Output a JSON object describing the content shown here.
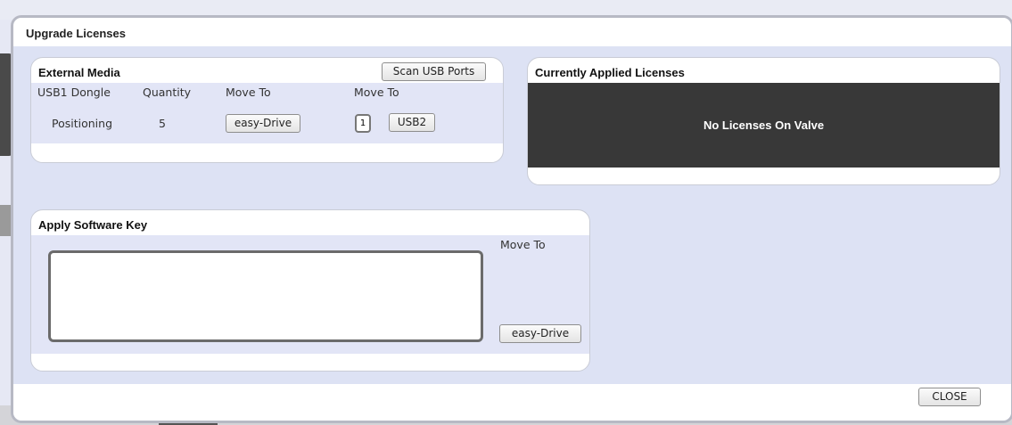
{
  "dialog": {
    "title": "Upgrade Licenses",
    "close_label": "CLOSE"
  },
  "external_media": {
    "title": "External Media",
    "scan_button": "Scan USB Ports",
    "columns": [
      "USB1 Dongle",
      "Quantity",
      "Move To",
      "Move To"
    ],
    "row": {
      "name": "Positioning",
      "quantity": "5",
      "move_to_button": "easy-Drive",
      "move_qty_value": "1",
      "move_to_usb_button": "USB2"
    }
  },
  "applied_licenses": {
    "title": "Currently Applied Licenses",
    "empty_message": "No Licenses On Valve"
  },
  "software_key": {
    "title": "Apply Software Key",
    "move_to_label": "Move To",
    "move_to_button": "easy-Drive",
    "key_value": ""
  },
  "colors": {
    "dialog_bg": "#dde2f4",
    "panel_body": "#e2e5f6",
    "dark_area": "#383838"
  }
}
